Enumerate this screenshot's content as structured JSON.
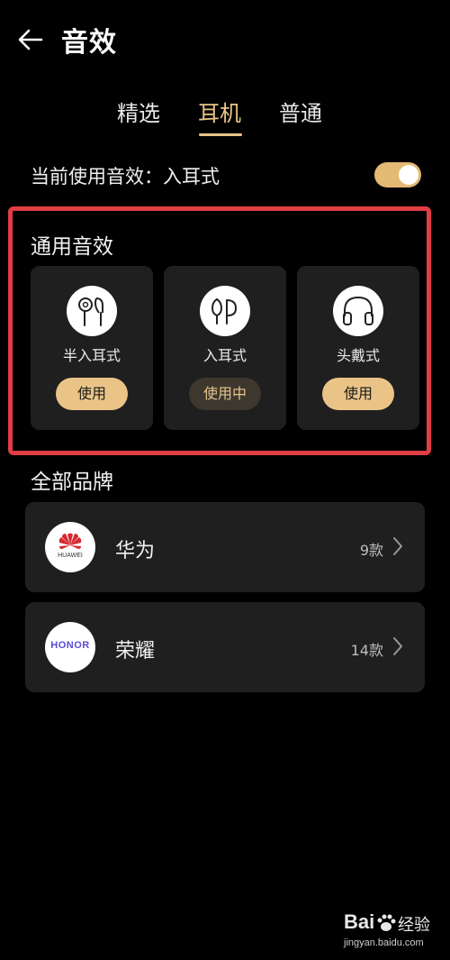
{
  "header": {
    "title": "音效",
    "back_icon": "arrow-left-icon"
  },
  "tabs": [
    {
      "label": "精选",
      "active": false
    },
    {
      "label": "耳机",
      "active": true
    },
    {
      "label": "普通",
      "active": false
    }
  ],
  "current": {
    "label": "当前使用音效：入耳式",
    "toggle_on": true
  },
  "general_effects": {
    "title": "通用音效",
    "items": [
      {
        "label": "半入耳式",
        "button": "使用",
        "in_use": false,
        "icon": "semi-in-ear-earbuds-icon"
      },
      {
        "label": "入耳式",
        "button": "使用中",
        "in_use": true,
        "icon": "in-ear-earbuds-icon"
      },
      {
        "label": "头戴式",
        "button": "使用",
        "in_use": false,
        "icon": "over-ear-headphones-icon"
      }
    ]
  },
  "brands": {
    "title": "全部品牌",
    "items": [
      {
        "name": "华为",
        "count": "9款",
        "logo_text": "HUAWEI",
        "logo": "huawei-logo"
      },
      {
        "name": "荣耀",
        "count": "14款",
        "logo_text": "HONOR",
        "logo": "honor-logo"
      }
    ]
  },
  "watermark": {
    "logo_text": "Bai",
    "logo_text2": "经验",
    "url": "jingyan.baidu.com"
  },
  "colors": {
    "accent": "#e8c488",
    "highlight": "#e03e44",
    "card_bg": "#1f1f1f"
  }
}
